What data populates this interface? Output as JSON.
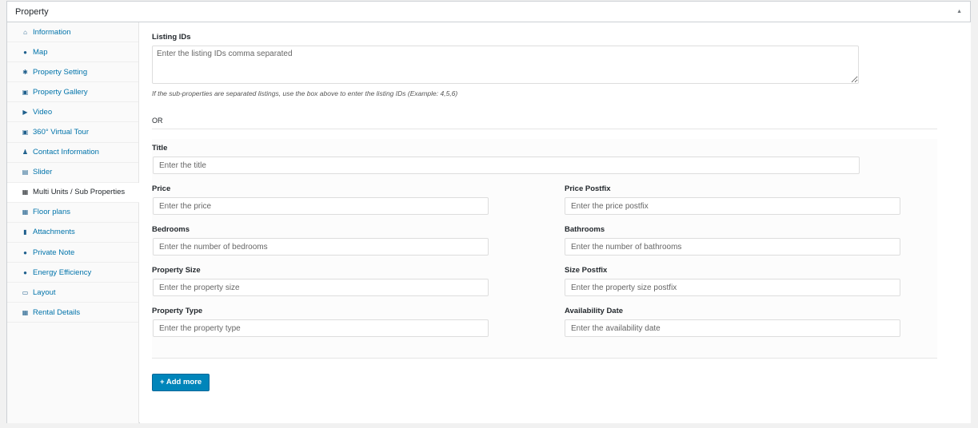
{
  "panel": {
    "title": "Property",
    "toggle": "▲"
  },
  "sidebar": {
    "items": [
      {
        "label": "Information",
        "icon": "home-icon",
        "glyph": "⌂"
      },
      {
        "label": "Map",
        "icon": "map-pin-icon",
        "glyph": "●"
      },
      {
        "label": "Property Setting",
        "icon": "gear-icon",
        "glyph": "✱"
      },
      {
        "label": "Property Gallery",
        "icon": "gallery-icon",
        "glyph": "▣"
      },
      {
        "label": "Video",
        "icon": "video-icon",
        "glyph": "▶"
      },
      {
        "label": "360° Virtual Tour",
        "icon": "virtual-tour-icon",
        "glyph": "▣"
      },
      {
        "label": "Contact Information",
        "icon": "user-icon",
        "glyph": "♟"
      },
      {
        "label": "Slider",
        "icon": "slider-icon",
        "glyph": "▤"
      },
      {
        "label": "Multi Units / Sub Properties",
        "icon": "building-icon",
        "glyph": "▦"
      },
      {
        "label": "Floor plans",
        "icon": "floorplan-icon",
        "glyph": "▦"
      },
      {
        "label": "Attachments",
        "icon": "book-icon",
        "glyph": "▮"
      },
      {
        "label": "Private Note",
        "icon": "pin-icon",
        "glyph": "●"
      },
      {
        "label": "Energy Efficiency",
        "icon": "bulb-icon",
        "glyph": "●"
      },
      {
        "label": "Layout",
        "icon": "layout-icon",
        "glyph": "▭"
      },
      {
        "label": "Rental Details",
        "icon": "table-icon",
        "glyph": "▦"
      }
    ],
    "active_index": 8
  },
  "form": {
    "listing_ids": {
      "label": "Listing IDs",
      "placeholder": "Enter the listing IDs comma separated"
    },
    "help": "If the sub-properties are separated listings, use the box above to enter the listing IDs (Example: 4,5,6)",
    "or": "OR",
    "title": {
      "label": "Title",
      "placeholder": "Enter the title"
    },
    "price": {
      "label": "Price",
      "placeholder": "Enter the price"
    },
    "price_postfix": {
      "label": "Price Postfix",
      "placeholder": "Enter the price postfix"
    },
    "bedrooms": {
      "label": "Bedrooms",
      "placeholder": "Enter the number of bedrooms"
    },
    "bathrooms": {
      "label": "Bathrooms",
      "placeholder": "Enter the number of bathrooms"
    },
    "property_size": {
      "label": "Property Size",
      "placeholder": "Enter the property size"
    },
    "size_postfix": {
      "label": "Size Postfix",
      "placeholder": "Enter the property size postfix"
    },
    "property_type": {
      "label": "Property Type",
      "placeholder": "Enter the property type"
    },
    "availability_date": {
      "label": "Availability Date",
      "placeholder": "Enter the availability date"
    },
    "add_more": "+ Add more"
  },
  "colors": {
    "accent": "#0085ba",
    "link": "#0073aa"
  }
}
